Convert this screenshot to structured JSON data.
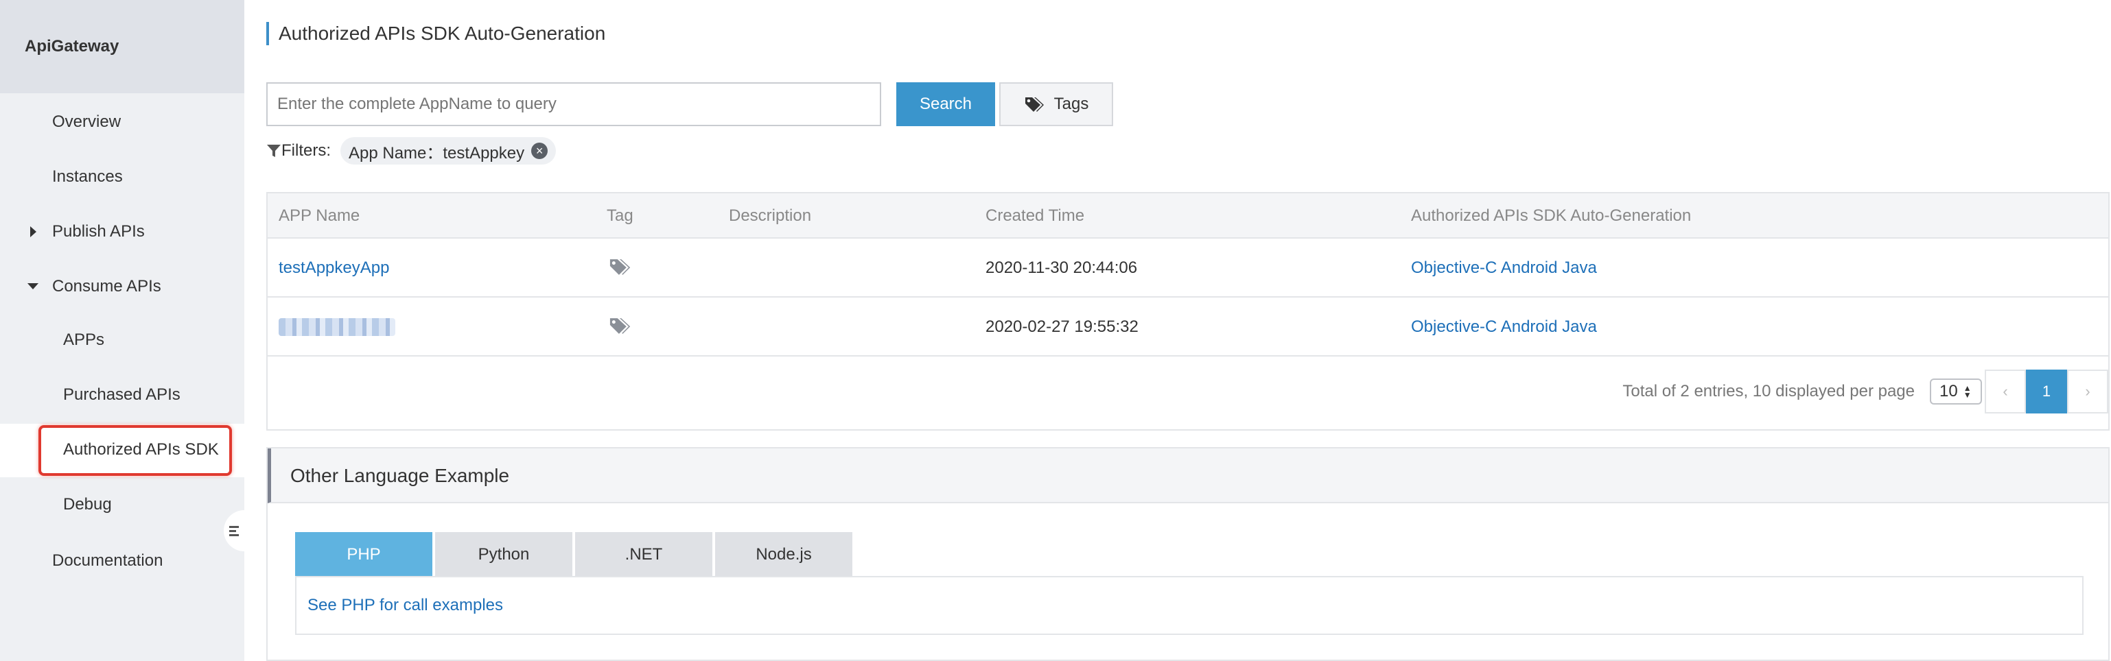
{
  "sidebar": {
    "product": "ApiGateway",
    "items": {
      "overview": "Overview",
      "instances": "Instances",
      "publish_apis": "Publish APIs",
      "consume_apis": "Consume APIs",
      "apps": "APPs",
      "purchased_apis": "Purchased APIs",
      "authorized_apis_sdk": "Authorized APIs SDK",
      "debug": "Debug",
      "documentation": "Documentation"
    },
    "active_item": "Authorized APIs SDK"
  },
  "header": {
    "title": "Authorized APIs SDK Auto-Generation"
  },
  "search": {
    "placeholder": "Enter the complete AppName to query",
    "button_label": "Search",
    "tags_label": "Tags"
  },
  "filters": {
    "label": "Filters:",
    "chip": "App Name：testAppkey"
  },
  "table": {
    "columns": [
      "APP Name",
      "Tag",
      "Description",
      "Created Time",
      "Authorized APIs SDK Auto-Generation"
    ],
    "rows": [
      {
        "app_name": "testAppkeyApp",
        "description": "",
        "created_time": "2020-11-30 20:44:06",
        "sdk_links": [
          "Objective-C",
          "Android",
          "Java"
        ]
      },
      {
        "app_name": "",
        "app_name_redacted": true,
        "description": "",
        "created_time": "2020-02-27 19:55:32",
        "sdk_links": [
          "Objective-C",
          "Android",
          "Java"
        ]
      }
    ]
  },
  "pagination": {
    "summary": "Total of 2 entries, 10 displayed per page",
    "page_size": "10",
    "prev": "‹",
    "next": "›",
    "current_page": "1"
  },
  "examples": {
    "title": "Other Language Example",
    "tabs": [
      "PHP",
      "Python",
      ".NET",
      "Node.js"
    ],
    "active_tab": "PHP",
    "content_link": "See PHP for call examples"
  },
  "colors": {
    "accent": "#3a95cc",
    "active_tab": "#5fb3e0",
    "link": "#1d6fb8",
    "highlight": "#e0392f"
  },
  "icons": [
    "tag-icon",
    "filter-icon",
    "clear-filter-icon",
    "collapse-sidebar-icon",
    "caret-right-icon",
    "caret-down-icon"
  ]
}
